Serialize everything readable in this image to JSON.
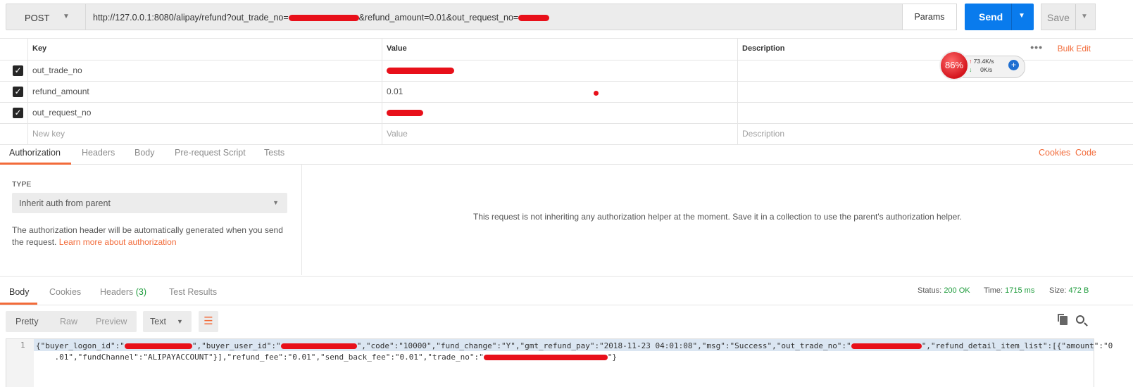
{
  "urlbar": {
    "method": "POST",
    "url_prefix": "http://127.0.0.1:8080/alipay/refund?out_trade_no=",
    "url_mid": "&refund_amount=0.01&out_request_no=",
    "params_label": "Params",
    "send_label": "Send",
    "save_label": "Save"
  },
  "params": {
    "headers": {
      "key": "Key",
      "value": "Value",
      "description": "Description"
    },
    "bulk_edit": "Bulk Edit",
    "rows": [
      {
        "key": "out_trade_no",
        "value": "",
        "checked": true
      },
      {
        "key": "refund_amount",
        "value": "0.01",
        "checked": true
      },
      {
        "key": "out_request_no",
        "value": "",
        "checked": true
      }
    ],
    "new_row": {
      "key": "New key",
      "value": "Value",
      "description": "Description"
    }
  },
  "widget": {
    "percent": "86%",
    "up": "73.4K/s",
    "down": "0K/s"
  },
  "request_tabs": {
    "items": [
      "Authorization",
      "Headers",
      "Body",
      "Pre-request Script",
      "Tests"
    ],
    "cookies": "Cookies",
    "code": "Code"
  },
  "auth": {
    "type_label": "TYPE",
    "type_value": "Inherit auth from parent",
    "description": "The authorization header will be automatically generated when you send the request. ",
    "link": "Learn more about authorization",
    "message": "This request is not inheriting any authorization helper at the moment. Save it in a collection to use the parent's authorization helper."
  },
  "response_tabs": {
    "body": "Body",
    "cookies": "Cookies",
    "headers": "Headers",
    "headers_count": "(3)",
    "test_results": "Test Results"
  },
  "response_status": {
    "status_label": "Status:",
    "status_value": "200 OK",
    "time_label": "Time:",
    "time_value": "1715 ms",
    "size_label": "Size:",
    "size_value": "472 B"
  },
  "response_view": {
    "modes": [
      "Pretty",
      "Raw",
      "Preview"
    ],
    "format": "Text"
  },
  "response_body": {
    "line_number": "1",
    "line1_a": "{\"buyer_logon_id\":\"",
    "line1_b": "\",\"buyer_user_id\":\"",
    "line1_c": "\",\"code\":\"10000\",\"fund_change\":\"Y\",\"gmt_refund_pay\":\"2018-11-23 04:01:08\",\"msg\":\"Success\",\"out_trade_no\":\"",
    "line1_d": "\",\"refund_detail_item_list\":[{\"amount\":\"0",
    "line2_a": "    .01\",\"fundChannel\":\"ALIPAYACCOUNT\"}],\"refund_fee\":\"0.01\",\"send_back_fee\":\"0.01\",\"trade_no\":\"",
    "line2_b": "\"}"
  }
}
